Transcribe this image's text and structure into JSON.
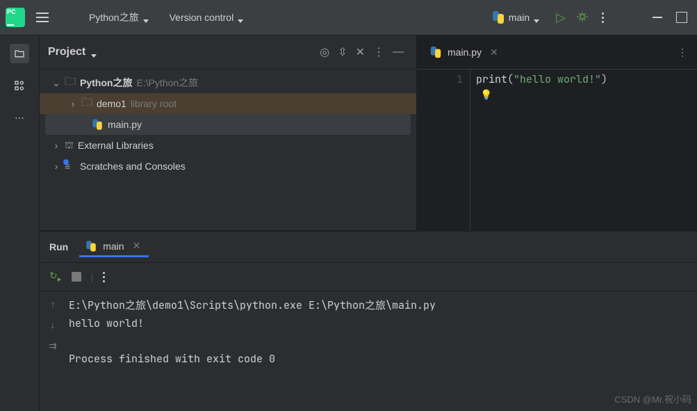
{
  "titlebar": {
    "project_name": "Python之旅",
    "vcs_label": "Version control",
    "run_config": "main"
  },
  "project_panel": {
    "title": "Project",
    "root_name": "Python之旅",
    "root_path": "E:\\Python之旅",
    "demo_folder": "demo1",
    "demo_hint": "library root",
    "main_file": "main.py",
    "ext_libs": "External Libraries",
    "scratches": "Scratches and Consoles"
  },
  "editor": {
    "tab_name": "main.py",
    "line_no": "1",
    "code_fn": "print",
    "code_open": "(",
    "code_str": "\"hello world!\"",
    "code_close": ")"
  },
  "run": {
    "title": "Run",
    "tab_name": "main",
    "output_line1": "E:\\Python之旅\\demo1\\Scripts\\python.exe E:\\Python之旅\\main.py",
    "output_line2": "hello world!",
    "output_line3": "",
    "output_line4": "Process finished with exit code 0"
  },
  "watermark": "CSDN @Mr.祝小码"
}
